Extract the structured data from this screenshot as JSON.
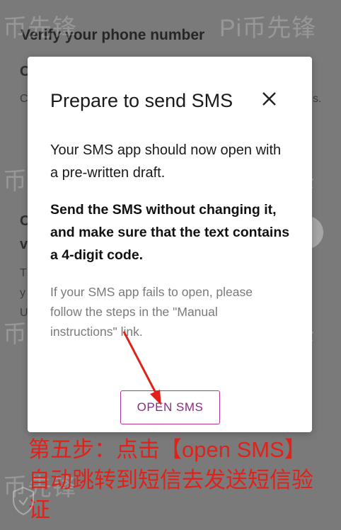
{
  "background": {
    "title": "Verify your phone number",
    "fragments": [
      "C",
      "C",
      "s.",
      "C",
      "v",
      "T",
      "y",
      "U"
    ]
  },
  "watermark": {
    "text_a": "币先锋",
    "text_b": "Pi币先锋"
  },
  "modal": {
    "title": "Prepare to send SMS",
    "close_icon": "close-icon",
    "paragraph1": "Your SMS app should now open with a pre-written draft.",
    "paragraph2": "Send the SMS without changing it, and make sure that the text contains a 4-digit code.",
    "paragraph3": "If your SMS app fails to open, please follow the steps in the \"Manual instructions\" link.",
    "open_sms_label": "OPEN SMS"
  },
  "carousel": {
    "next_icon": "chevron-right-icon"
  },
  "annotation": {
    "line1": "第五步：点击【open SMS】",
    "line2": "自动跳转到短信去发送短信验",
    "line3": "证",
    "color": "#e0221b"
  },
  "colors": {
    "accent": "#b3339e",
    "overlay": "#7a7a7a",
    "annotation_red": "#e0221b"
  }
}
